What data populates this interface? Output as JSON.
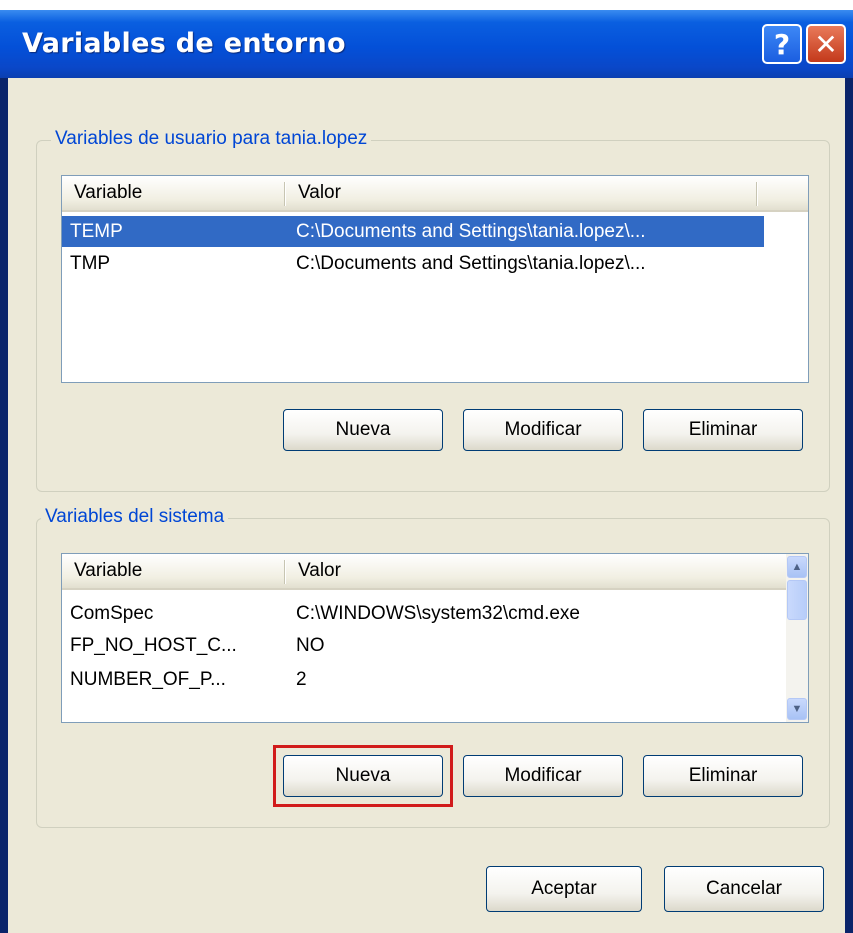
{
  "window": {
    "title": "Variables de entorno"
  },
  "user_vars": {
    "legend": "Variables de usuario para tania.lopez",
    "columns": [
      "Variable",
      "Valor"
    ],
    "rows": [
      {
        "variable": "TEMP",
        "valor": "C:\\Documents and Settings\\tania.lopez\\...",
        "selected": true
      },
      {
        "variable": "TMP",
        "valor": "C:\\Documents and Settings\\tania.lopez\\...",
        "selected": false
      }
    ],
    "buttons": {
      "new": "Nueva",
      "edit": "Modificar",
      "delete": "Eliminar"
    }
  },
  "system_vars": {
    "legend": "Variables del sistema",
    "columns": [
      "Variable",
      "Valor"
    ],
    "rows": [
      {
        "variable": "ComSpec",
        "valor": "C:\\WINDOWS\\system32\\cmd.exe"
      },
      {
        "variable": "FP_NO_HOST_C...",
        "valor": "NO"
      },
      {
        "variable": "NUMBER_OF_P...",
        "valor": "2"
      }
    ],
    "buttons": {
      "new": "Nueva",
      "edit": "Modificar",
      "delete": "Eliminar"
    }
  },
  "footer": {
    "ok": "Aceptar",
    "cancel": "Cancelar"
  },
  "colors": {
    "highlight": "#d11b1b",
    "selection": "#316ac5",
    "legend": "#0046d5"
  }
}
